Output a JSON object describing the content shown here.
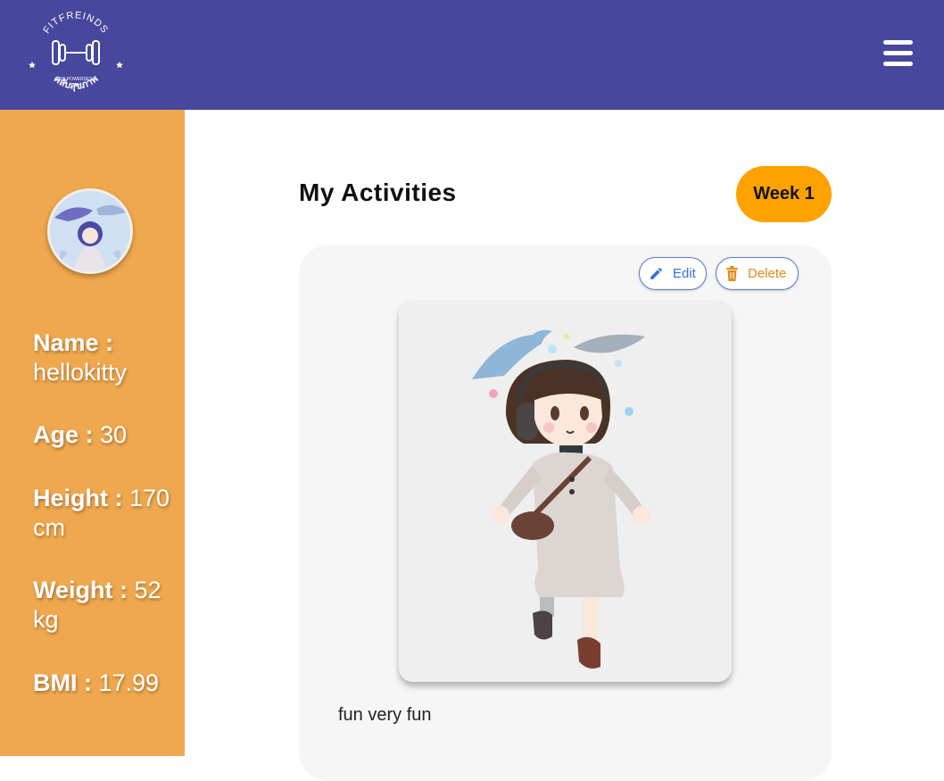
{
  "header": {
    "logo_top_text": "FITFREINDS",
    "logo_bottom_text": "คลับสุขภาพ",
    "logo_small_text": "OF POWERSET",
    "menu_icon": "hamburger-icon",
    "background_color": "#46479d"
  },
  "sidebar": {
    "background_color": "#f0a84e",
    "avatar_icon": "profile-avatar",
    "name_label": "Name :",
    "name_value": "hellokitty",
    "age_label": "Age :",
    "age_value": "30",
    "height_label": "Height :",
    "height_value": "170 cm",
    "weight_label": "Weight :",
    "weight_value": "52 kg",
    "bmi_label": "BMI :",
    "bmi_value": "17.99"
  },
  "main": {
    "title": "My Activities",
    "week_label": "Week 1",
    "week_color": "#ffa200",
    "activity": {
      "edit_label": "Edit",
      "edit_icon": "pencil-icon",
      "delete_label": "Delete",
      "delete_icon": "trash-icon",
      "image_icon": "activity-photo",
      "description": "fun very fun"
    }
  }
}
